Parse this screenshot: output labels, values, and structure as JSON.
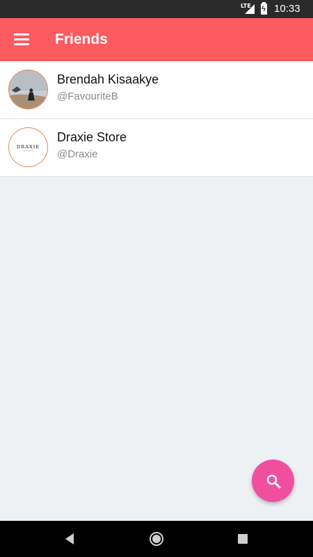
{
  "status_bar": {
    "network": "LTE",
    "time": "10:33"
  },
  "app_bar": {
    "title": "Friends",
    "menu_icon": "hamburger-menu-icon"
  },
  "friends": [
    {
      "name": "Brendah Kisaakye",
      "handle": "@FavouriteB"
    },
    {
      "name": "Draxie Store",
      "handle": "@Draxie",
      "avatar_text": "DRAXIE"
    }
  ],
  "fab": {
    "icon": "search-icon",
    "color": "#f04fa0"
  },
  "colors": {
    "app_bar": "#fd5b60",
    "background": "#eef1f4",
    "avatar_ring": "#f07a4c"
  }
}
